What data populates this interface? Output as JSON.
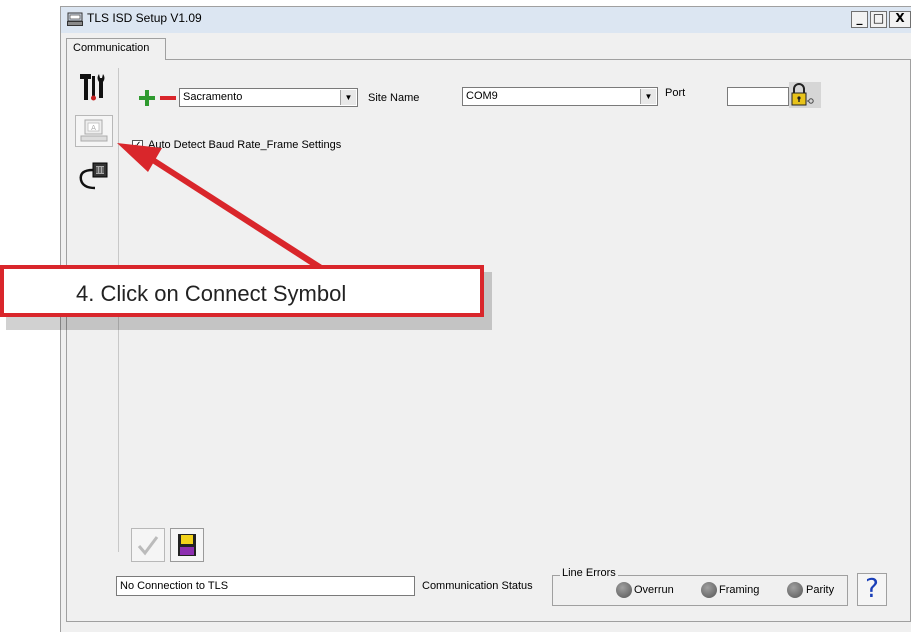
{
  "window": {
    "title": "TLS ISD Setup V1.09",
    "controls": [
      "_",
      "□",
      "X"
    ]
  },
  "tabs": [
    {
      "label": "Communication",
      "active": true
    }
  ],
  "toolstrip": [
    {
      "icon": "tools-icon"
    },
    {
      "icon": "connect-icon",
      "disabled": true
    },
    {
      "icon": "cable-plug-icon"
    }
  ],
  "site": {
    "add_icon": "plus-icon",
    "remove_icon": "minus-icon",
    "value": "Sacramento",
    "label": "Site Name"
  },
  "port": {
    "value": "COM9",
    "label": "Port",
    "input_value": "",
    "lock_icon": "padlock-key-icon"
  },
  "auto_detect": {
    "checked": true,
    "label": "Auto Detect Baud Rate_Frame Settings"
  },
  "bottom": {
    "ok_icon": "checkmark-icon",
    "save_icon": "floppy-disk-icon",
    "status_value": "No Connection to TLS",
    "status_label": "Communication Status",
    "line_errors": {
      "label": "Line Errors",
      "items": [
        "Overrun",
        "Framing",
        "Parity"
      ]
    },
    "help_label": "?"
  },
  "annotation": {
    "text": "4.  Click on Connect Symbol",
    "color": "#d9262b"
  }
}
